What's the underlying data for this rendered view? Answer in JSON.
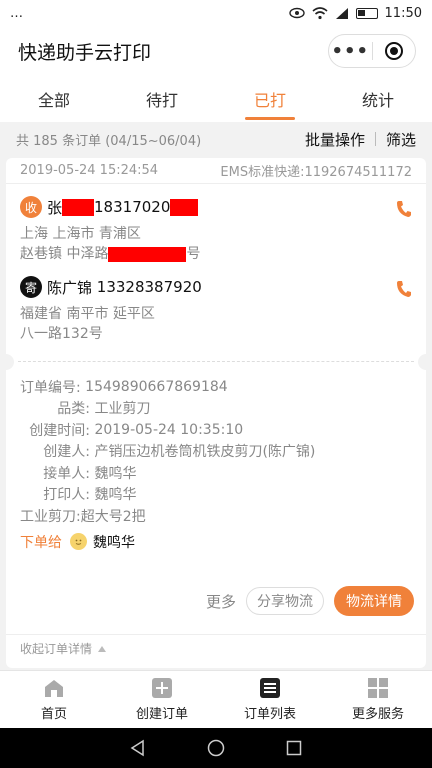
{
  "statusbar": {
    "left_glyph": "…",
    "time": "11:50"
  },
  "app": {
    "title": "快递助手云打印"
  },
  "tabs": [
    {
      "label": "全部"
    },
    {
      "label": "待打"
    },
    {
      "label": "已打",
      "active": true
    },
    {
      "label": "统计"
    }
  ],
  "summary": {
    "text": "共 185 条订单 (04/15~06/04)",
    "batch_label": "批量操作",
    "filter_label": "筛选"
  },
  "order": {
    "datetime": "2019-05-24 15:24:54",
    "courier_tracking": "EMS标准快递:1192674511172",
    "recipient": {
      "badge": "收",
      "name_visible": "张",
      "phone_visible": "18317020",
      "address_line1": "上海 上海市 青浦区",
      "address_line2_prefix": "赵巷镇 中泽路",
      "address_line2_suffix": "号"
    },
    "sender": {
      "badge": "寄",
      "name": "陈广锦",
      "phone": "13328387920",
      "address_line1": "福建省 南平市 延平区",
      "address_line2": "八一路132号"
    },
    "details": [
      {
        "label": "订单编号:",
        "value": "1549890667869184"
      },
      {
        "label": "品类:",
        "value": "工业剪刀"
      },
      {
        "label": "创建时间:",
        "value": "2019-05-24 10:35:10"
      },
      {
        "label": "创建人:",
        "value": "产销压边机卷筒机铁皮剪刀(陈广锦)"
      },
      {
        "label": "接单人:",
        "value": "魏鸣华"
      },
      {
        "label": "打印人:",
        "value": "魏鸣华"
      }
    ],
    "item_note": "工业剪刀:超大号2把",
    "assign_label": "下单给",
    "assign_name": "魏鸣华",
    "actions": {
      "more": "更多",
      "share": "分享物流",
      "detail": "物流详情"
    },
    "collapse_label": "收起订单详情"
  },
  "bottomnav": [
    {
      "label": "首页",
      "icon": "home-icon"
    },
    {
      "label": "创建订单",
      "icon": "plus-icon"
    },
    {
      "label": "订单列表",
      "icon": "list-icon",
      "active": true
    },
    {
      "label": "更多服务",
      "icon": "grid-icon"
    }
  ],
  "colors": {
    "accent": "#f0813a",
    "redaction": "#ff0000"
  }
}
